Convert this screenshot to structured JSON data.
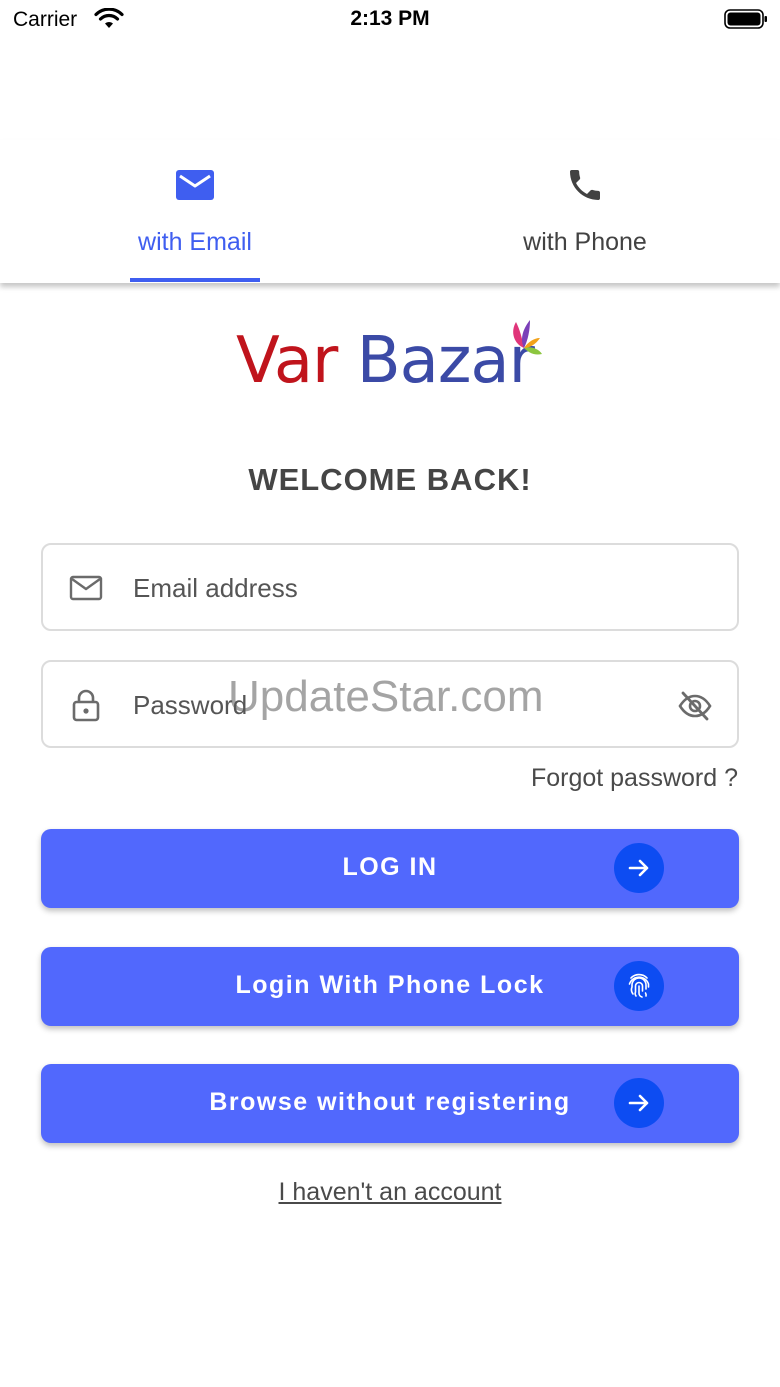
{
  "status_bar": {
    "carrier": "Carrier",
    "time": "2:13 PM"
  },
  "tabs": [
    {
      "label": "with Email",
      "icon": "mail-icon",
      "active": true
    },
    {
      "label": "with Phone",
      "icon": "phone-icon",
      "active": false
    }
  ],
  "logo": {
    "word1": "Var",
    "word2": "Bazar"
  },
  "welcome": "WELCOME BACK!",
  "form": {
    "email_placeholder": "Email address",
    "password_placeholder": "Password",
    "forgot_label": "Forgot password ?"
  },
  "watermark": "UpdateStar.com",
  "buttons": {
    "login": "LOG IN",
    "phone_lock": "Login With Phone Lock",
    "browse": "Browse without registering"
  },
  "no_account": "I haven't an account",
  "colors": {
    "accent": "#3f5ef0",
    "button": "#5168fd",
    "button_circle": "#0d4cf2",
    "logo_red": "#c0141c",
    "logo_blue": "#3b4aa6"
  }
}
